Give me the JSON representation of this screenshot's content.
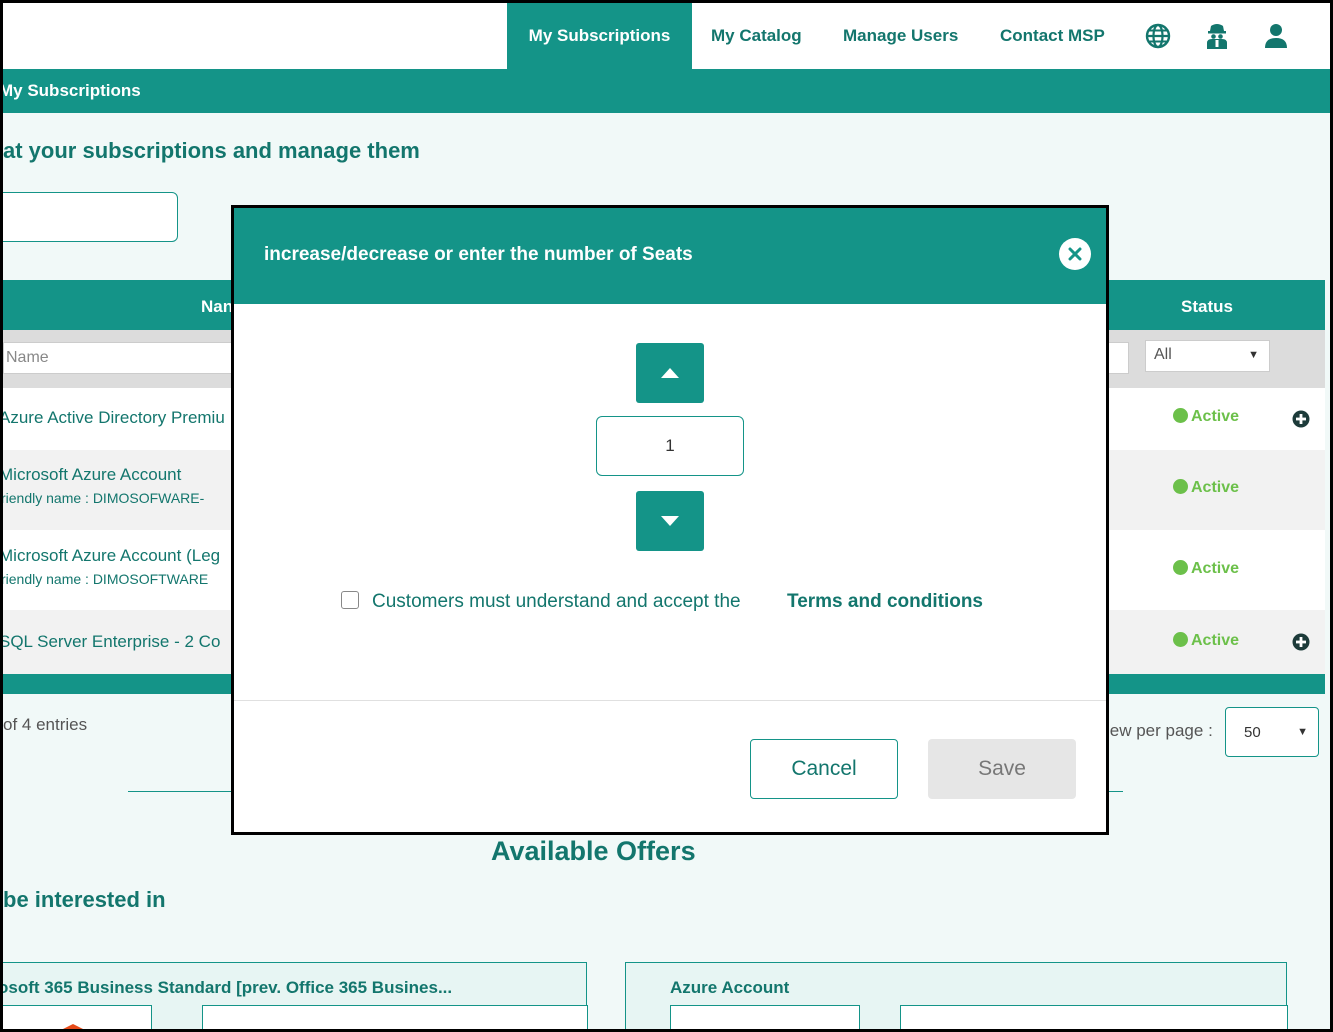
{
  "nav": {
    "items": [
      {
        "label": "My Subscriptions",
        "active": true
      },
      {
        "label": "My Catalog"
      },
      {
        "label": "Manage Users"
      },
      {
        "label": "Contact MSP"
      }
    ],
    "icons": [
      "globe-icon",
      "support-agent-icon",
      "user-icon"
    ]
  },
  "breadcrumb": {
    "title": "My Subscriptions"
  },
  "page": {
    "headline": "at your subscriptions and manage them"
  },
  "table": {
    "headers": {
      "name": "Nan",
      "status": "Status"
    },
    "filters": {
      "name_placeholder": "Name",
      "status_value": "All"
    },
    "rows": [
      {
        "name": "Azure Active Directory Premiu",
        "status": "Active",
        "expandable": true
      },
      {
        "name": "Microsoft Azure Account",
        "sub": "riendly name : DIMOSOFWARE-",
        "status": "Active"
      },
      {
        "name": "Microsoft Azure Account (Leg",
        "sub": "riendly name : DIMOSOFTWARE",
        "status": "Active"
      },
      {
        "name": "SQL Server Enterprise - 2 Co",
        "status": "Active",
        "expandable": true
      }
    ],
    "entries_text": "of 4 entries",
    "per_page_label": "iew per page :",
    "per_page_value": "50"
  },
  "offers": {
    "title": "Available Offers",
    "interested": "be interested in",
    "cards": [
      {
        "title": "osoft 365 Business Standard [prev. Office 365 Busines..."
      },
      {
        "title": "Azure Account"
      }
    ]
  },
  "modal": {
    "title": "increase/decrease or enter the number of Seats",
    "quantity": "1",
    "terms_text": "Customers must understand and accept the",
    "terms_link": "Terms and conditions",
    "cancel_label": "Cancel",
    "save_label": "Save"
  },
  "colors": {
    "primary": "#149488",
    "text_teal": "#13766d",
    "status_active": "#6cc04a"
  }
}
